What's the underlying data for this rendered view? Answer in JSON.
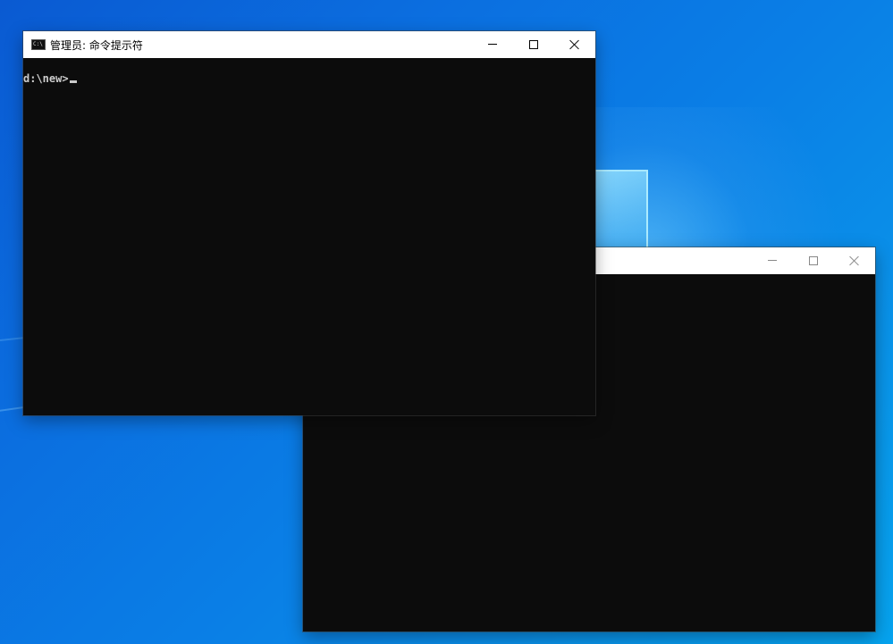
{
  "desktop": {
    "background_color": "#0a7fe6"
  },
  "front_window": {
    "title": "管理员: 命令提示符",
    "icon": "cmd-icon",
    "prompt": "d:\\new>",
    "controls": {
      "minimize_icon": "minimize-icon",
      "maximize_icon": "maximize-icon",
      "close_icon": "close-icon"
    }
  },
  "back_window": {
    "title": "",
    "controls": {
      "minimize_icon": "minimize-icon",
      "maximize_icon": "maximize-icon",
      "close_icon": "close-icon"
    }
  },
  "colors": {
    "console_background": "#0c0c0c",
    "console_text": "#cccccc",
    "titlebar": "#ffffff"
  }
}
